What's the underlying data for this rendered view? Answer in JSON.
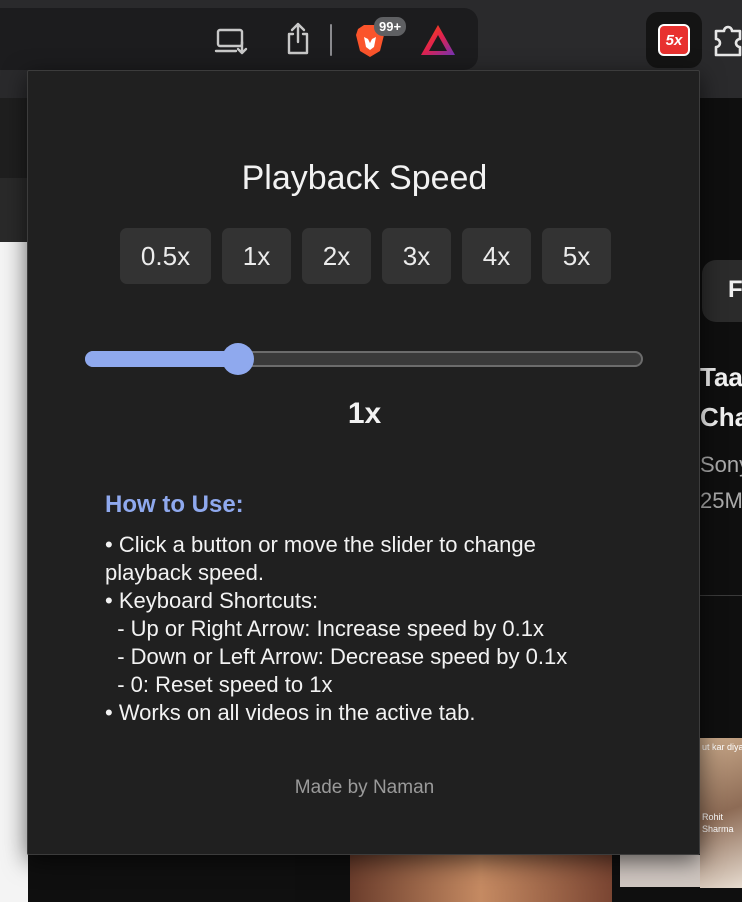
{
  "toolbar": {
    "icons": [
      "laptop-download-icon",
      "share-icon",
      "brave-lion-icon",
      "brave-rewards-triangle-icon",
      "speed-extension-icon",
      "puzzle-extensions-icon"
    ],
    "badge": "99+",
    "extension_label": "5x"
  },
  "background": {
    "chip_label": "F",
    "title_line1": "Taa",
    "title_line2": "Cha",
    "meta_line1": "Sony",
    "meta_line2": "25M",
    "thumb_caption1": "ut kar diya,",
    "thumb_caption2": "Rohit",
    "thumb_caption3": "Sharma"
  },
  "popup": {
    "title": "Playback Speed",
    "speed_buttons": [
      "0.5x",
      "1x",
      "2x",
      "3x",
      "4x",
      "5x"
    ],
    "slider": {
      "min": 0.5,
      "max": 5,
      "value": 1
    },
    "current_speed": "1x",
    "howto_title": "How to Use:",
    "howto_lines": [
      "• Click a button or move the slider to change",
      "playback speed.",
      "• Keyboard Shortcuts:",
      "  - Up or Right Arrow: Increase speed by 0.1x",
      "  - Down or Left Arrow: Decrease speed by 0.1x",
      "  - 0: Reset speed to 1x",
      "• Works on all videos in the active tab."
    ],
    "footer": "Made by Naman"
  },
  "colors": {
    "accent": "#8fa9ee",
    "popup_bg": "#202020",
    "button_bg": "#333333"
  }
}
